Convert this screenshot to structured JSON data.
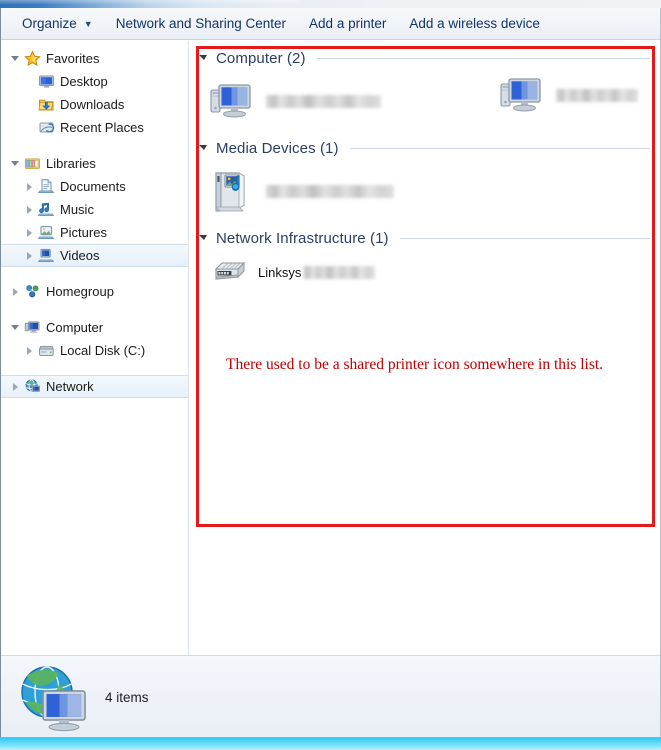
{
  "window": {
    "title": "Network"
  },
  "toolbar": {
    "organize": "Organize",
    "organize_caret": "▼",
    "network_sharing_center": "Network and Sharing Center",
    "add_printer": "Add a printer",
    "add_wireless_device": "Add a wireless device"
  },
  "sidebar": {
    "groups": [
      {
        "header": {
          "label": "Favorites",
          "icon": "star-icon",
          "expander": "open"
        },
        "items": [
          {
            "label": "Desktop",
            "icon": "desktop-icon",
            "expander": "none",
            "selected": false
          },
          {
            "label": "Downloads",
            "icon": "downloads-folder-icon",
            "expander": "none",
            "selected": false
          },
          {
            "label": "Recent Places",
            "icon": "recent-places-icon",
            "expander": "none",
            "selected": false
          }
        ]
      },
      {
        "header": {
          "label": "Libraries",
          "icon": "libraries-icon",
          "expander": "open"
        },
        "items": [
          {
            "label": "Documents",
            "icon": "documents-library-icon",
            "expander": "closed",
            "selected": false
          },
          {
            "label": "Music",
            "icon": "music-library-icon",
            "expander": "closed",
            "selected": false
          },
          {
            "label": "Pictures",
            "icon": "pictures-library-icon",
            "expander": "closed",
            "selected": false
          },
          {
            "label": "Videos",
            "icon": "videos-library-icon",
            "expander": "closed",
            "selected": true
          }
        ]
      },
      {
        "header": {
          "label": "Homegroup",
          "icon": "homegroup-icon",
          "expander": "closed"
        },
        "items": []
      },
      {
        "header": {
          "label": "Computer",
          "icon": "computer-icon",
          "expander": "open"
        },
        "items": [
          {
            "label": "Local Disk (C:)",
            "icon": "local-disk-icon",
            "expander": "closed",
            "selected": false
          }
        ]
      },
      {
        "header": {
          "label": "Network",
          "icon": "network-globe-icon",
          "expander": "closed",
          "selected": true
        },
        "items": []
      }
    ]
  },
  "content": {
    "groups": [
      {
        "title": "Computer (2)",
        "name": "computer",
        "items": [
          {
            "label": "",
            "redacted": true,
            "redacted_width": 115,
            "icon": "computer-monitor-icon"
          },
          {
            "label": "",
            "redacted": true,
            "redacted_width": 82,
            "icon": "computer-monitor-icon"
          }
        ]
      },
      {
        "title": "Media Devices (1)",
        "name": "media-devices",
        "items": [
          {
            "label": "",
            "redacted": true,
            "redacted_width": 128,
            "icon": "media-device-icon"
          }
        ]
      },
      {
        "title": "Network Infrastructure (1)",
        "name": "network-infrastructure",
        "items": [
          {
            "label": "Linksys",
            "redacted": true,
            "redacted_width": 72,
            "icon": "router-icon"
          }
        ]
      }
    ]
  },
  "annotation": {
    "text": "There used to be a shared printer icon somewhere in this list.",
    "color": "#c00000",
    "box_color": "#e41a1a"
  },
  "statusbar": {
    "icon": "network-globe-computer-icon",
    "item_count": "4 items"
  }
}
